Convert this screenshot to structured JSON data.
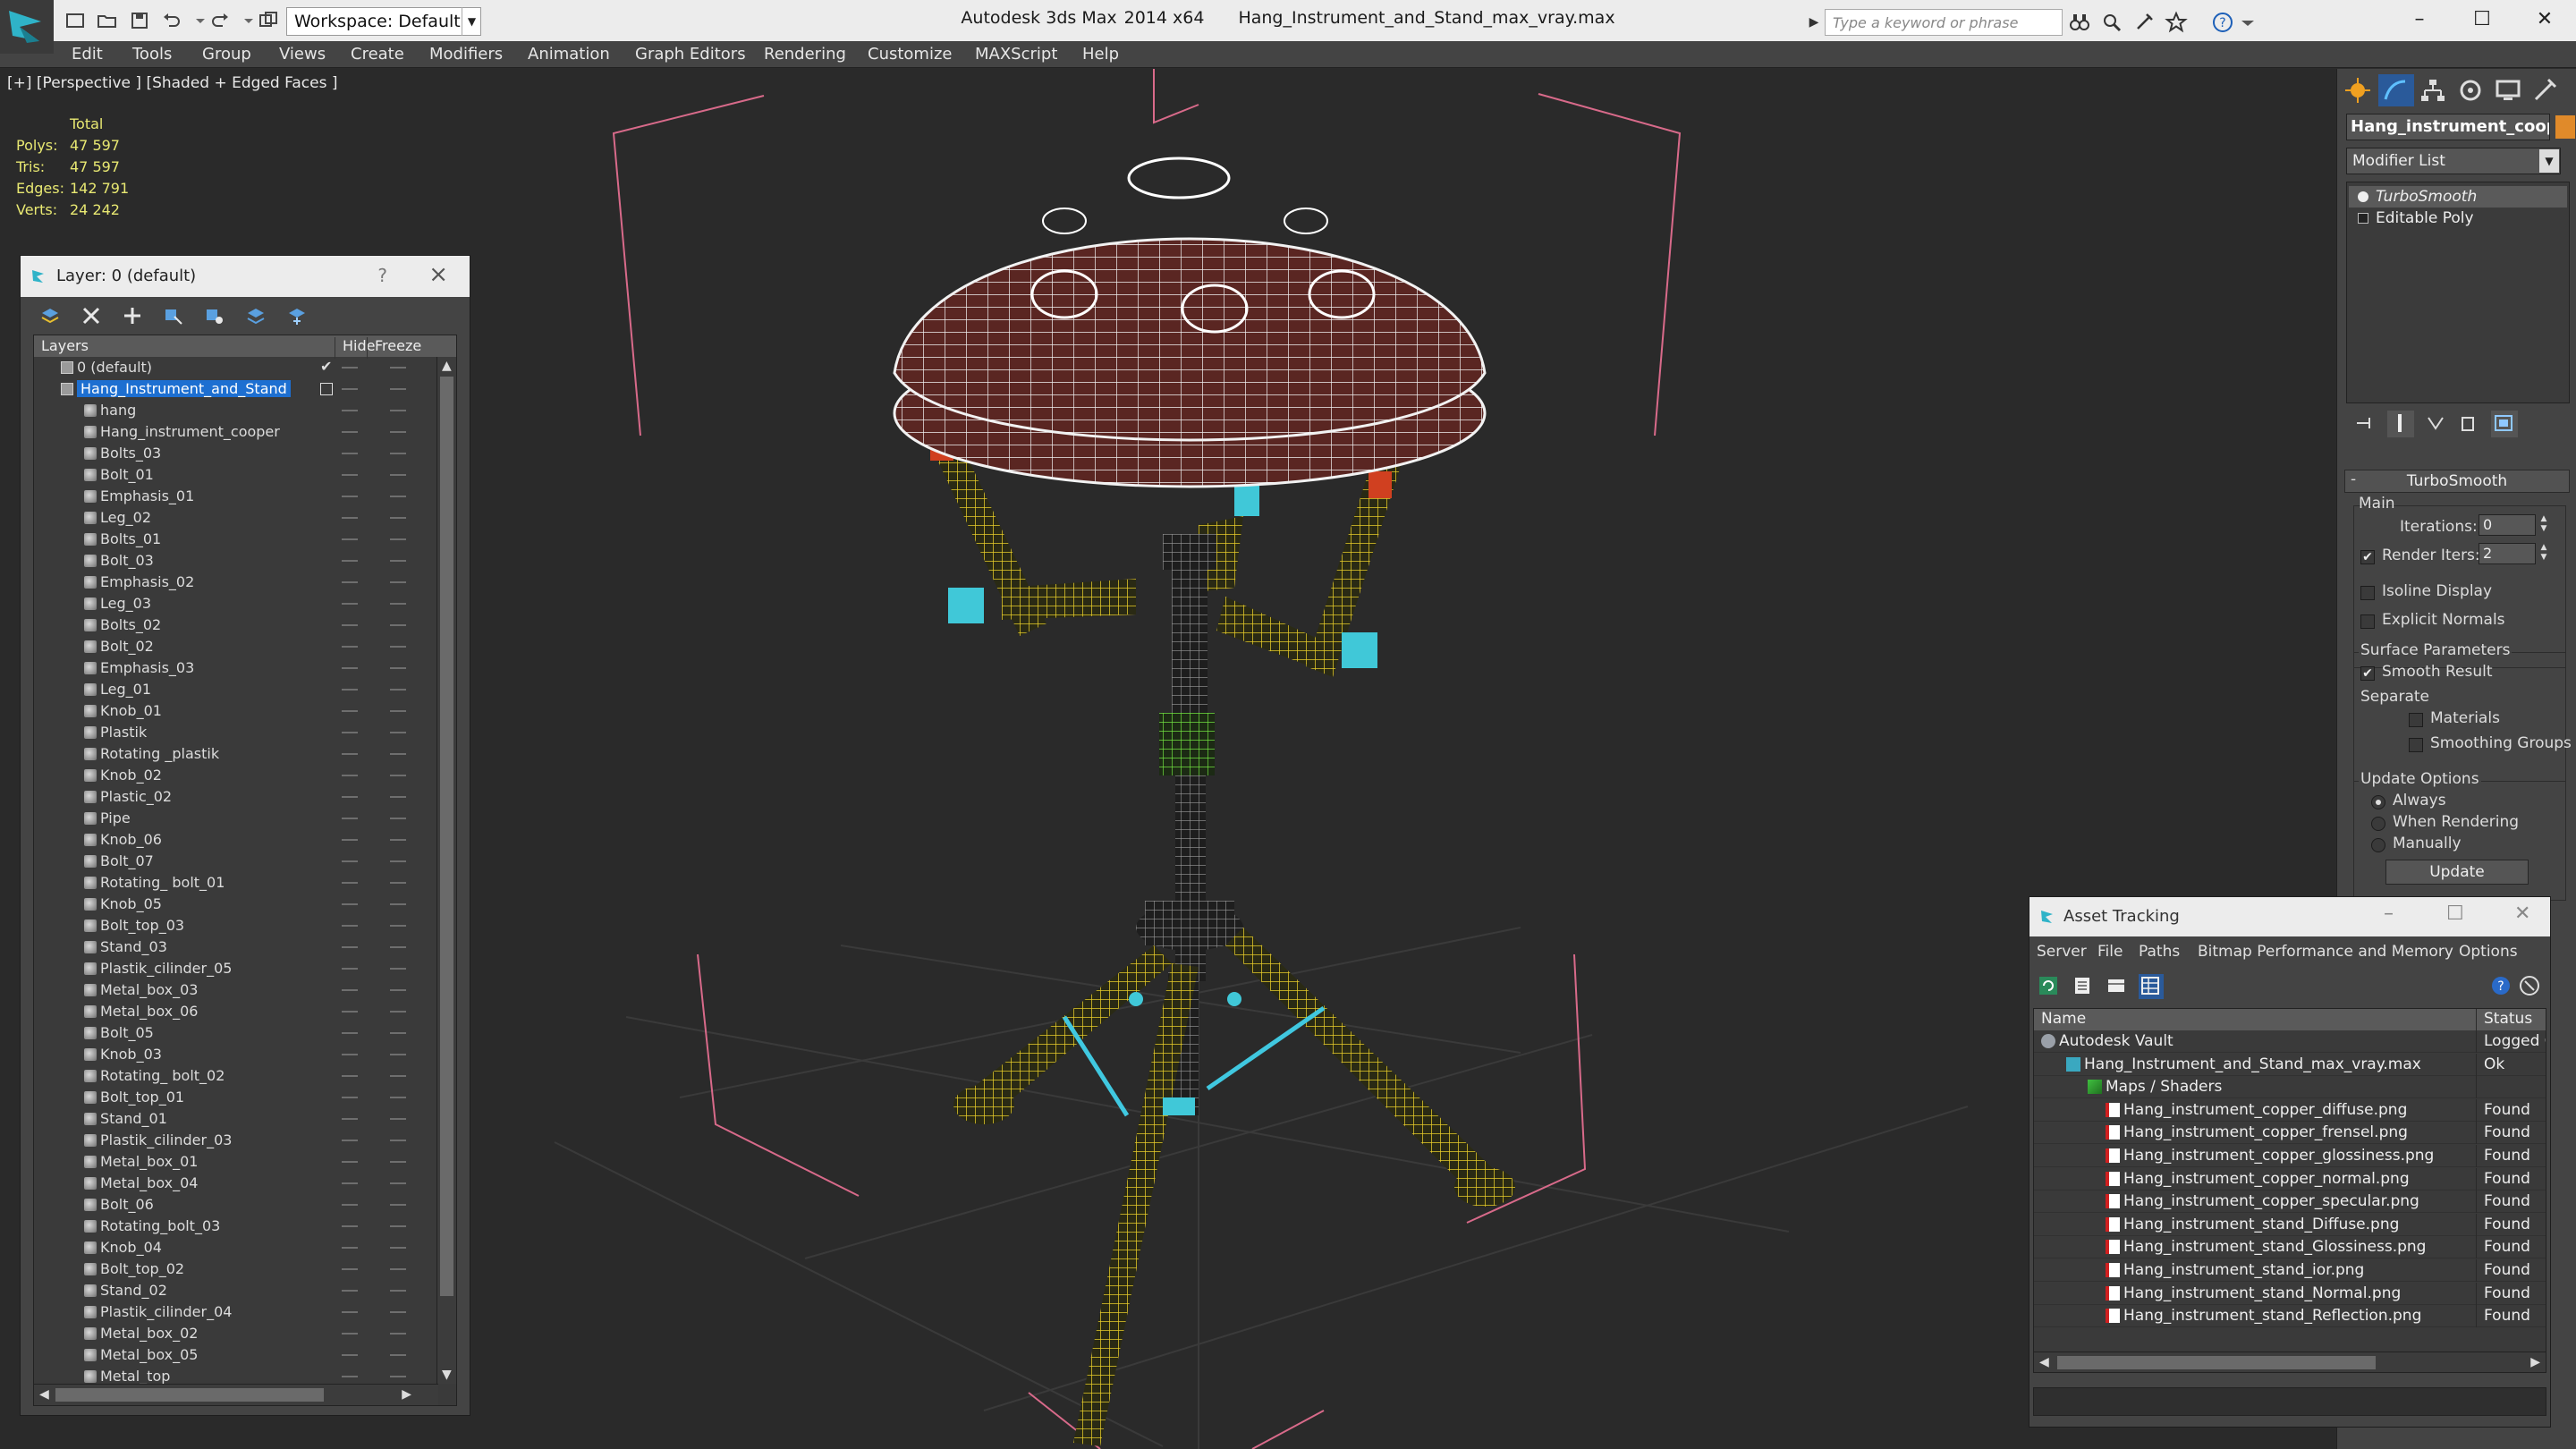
{
  "titlebar": {
    "workspace_label": "Workspace: Default",
    "app_name": "Autodesk 3ds Max",
    "version": "2014 x64",
    "file_name": "Hang_Instrument_and_Stand_max_vray.max",
    "search_placeholder": "Type a keyword or phrase"
  },
  "menu": [
    "Edit",
    "Tools",
    "Group",
    "Views",
    "Create",
    "Modifiers",
    "Animation",
    "Graph Editors",
    "Rendering",
    "Customize",
    "MAXScript",
    "Help"
  ],
  "viewport": {
    "label": "[+] [Perspective ] [Shaded + Edged Faces ]",
    "stats": {
      "header": "Total",
      "rows": [
        {
          "key": "Polys:",
          "value": "47 597"
        },
        {
          "key": "Tris:",
          "value": "47 597"
        },
        {
          "key": "Edges:",
          "value": "142 791"
        },
        {
          "key": "Verts:",
          "value": "24 242"
        }
      ]
    }
  },
  "layer_panel": {
    "title": "Layer: 0 (default)",
    "help": "?",
    "close": "×",
    "columns": {
      "layers": "Layers",
      "hide": "Hide",
      "freeze": "Freeze"
    },
    "layers": [
      {
        "name": "0 (default)",
        "level": 0
      },
      {
        "name": "Hang_Instrument_and_Stand",
        "level": 0,
        "selected": true
      }
    ],
    "objects": [
      "hang",
      "Hang_instrument_cooper",
      "Bolts_03",
      "Bolt_01",
      "Emphasis_01",
      "Leg_02",
      "Bolts_01",
      "Bolt_03",
      "Emphasis_02",
      "Leg_03",
      "Bolts_02",
      "Bolt_02",
      "Emphasis_03",
      "Leg_01",
      "Knob_01",
      "Plastik",
      "Rotating _plastik",
      "Knob_02",
      "Plastic_02",
      "Pipe",
      "Knob_06",
      "Bolt_07",
      "Rotating_ bolt_01",
      "Knob_05",
      "Bolt_top_03",
      "Stand_03",
      "Plastik_cilinder_05",
      "Metal_box_03",
      "Metal_box_06",
      "Bolt_05",
      "Knob_03",
      "Rotating_ bolt_02",
      "Bolt_top_01",
      "Stand_01",
      "Plastik_cilinder_03",
      "Metal_box_01",
      "Metal_box_04",
      "Bolt_06",
      "Rotating_bolt_03",
      "Knob_04",
      "Bolt_top_02",
      "Stand_02",
      "Plastik_cilinder_04",
      "Metal_box_02",
      "Metal_box_05",
      "Metal_top"
    ]
  },
  "command_panel": {
    "object_name": "Hang_instrument_cooper",
    "object_color": "#e08a2a",
    "modifier_list": "Modifier List",
    "stack": [
      "TurboSmooth",
      "Editable Poly"
    ],
    "turbosmooth": {
      "title": "TurboSmooth",
      "main_label": "Main",
      "iterations_label": "Iterations:",
      "iterations_value": "0",
      "render_iters_label": "Render Iters:",
      "render_iters_value": "2",
      "isoline_label": "Isoline Display",
      "explicit_normals_label": "Explicit Normals",
      "surface_params_label": "Surface Parameters",
      "smooth_result_label": "Smooth Result",
      "separate_label": "Separate",
      "materials_label": "Materials",
      "smoothing_groups_label": "Smoothing Groups",
      "update_options_label": "Update Options",
      "always_label": "Always",
      "when_rendering_label": "When Rendering",
      "manually_label": "Manually",
      "update_button": "Update"
    }
  },
  "asset_panel": {
    "title": "Asset Tracking",
    "menu": [
      "Server",
      "File",
      "Paths",
      "Bitmap Performance and Memory",
      "Options"
    ],
    "columns": {
      "name": "Name",
      "status": "Status"
    },
    "rows": [
      {
        "name": "Autodesk Vault",
        "status": "Logged Out",
        "indent": 0,
        "icon": "vault-icon"
      },
      {
        "name": "Hang_Instrument_and_Stand_max_vray.max",
        "status": "Ok",
        "indent": 1,
        "icon": "max-file-icon"
      },
      {
        "name": "Maps / Shaders",
        "status": "",
        "indent": 2,
        "icon": "maps-icon"
      },
      {
        "name": "Hang_instrument_copper_diffuse.png",
        "status": "Found",
        "indent": 3,
        "icon": "png-icon"
      },
      {
        "name": "Hang_instrument_copper_frensel.png",
        "status": "Found",
        "indent": 3,
        "icon": "png-icon"
      },
      {
        "name": "Hang_instrument_copper_glossiness.png",
        "status": "Found",
        "indent": 3,
        "icon": "png-icon"
      },
      {
        "name": "Hang_instrument_copper_normal.png",
        "status": "Found",
        "indent": 3,
        "icon": "png-icon"
      },
      {
        "name": "Hang_instrument_copper_specular.png",
        "status": "Found",
        "indent": 3,
        "icon": "png-icon"
      },
      {
        "name": "Hang_instrument_stand_Diffuse.png",
        "status": "Found",
        "indent": 3,
        "icon": "png-icon"
      },
      {
        "name": "Hang_instrument_stand_Glossiness.png",
        "status": "Found",
        "indent": 3,
        "icon": "png-icon"
      },
      {
        "name": "Hang_instrument_stand_ior.png",
        "status": "Found",
        "indent": 3,
        "icon": "png-icon"
      },
      {
        "name": "Hang_instrument_stand_Normal.png",
        "status": "Found",
        "indent": 3,
        "icon": "png-icon"
      },
      {
        "name": "Hang_instrument_stand_Reflection.png",
        "status": "Found",
        "indent": 3,
        "icon": "png-icon"
      }
    ]
  }
}
